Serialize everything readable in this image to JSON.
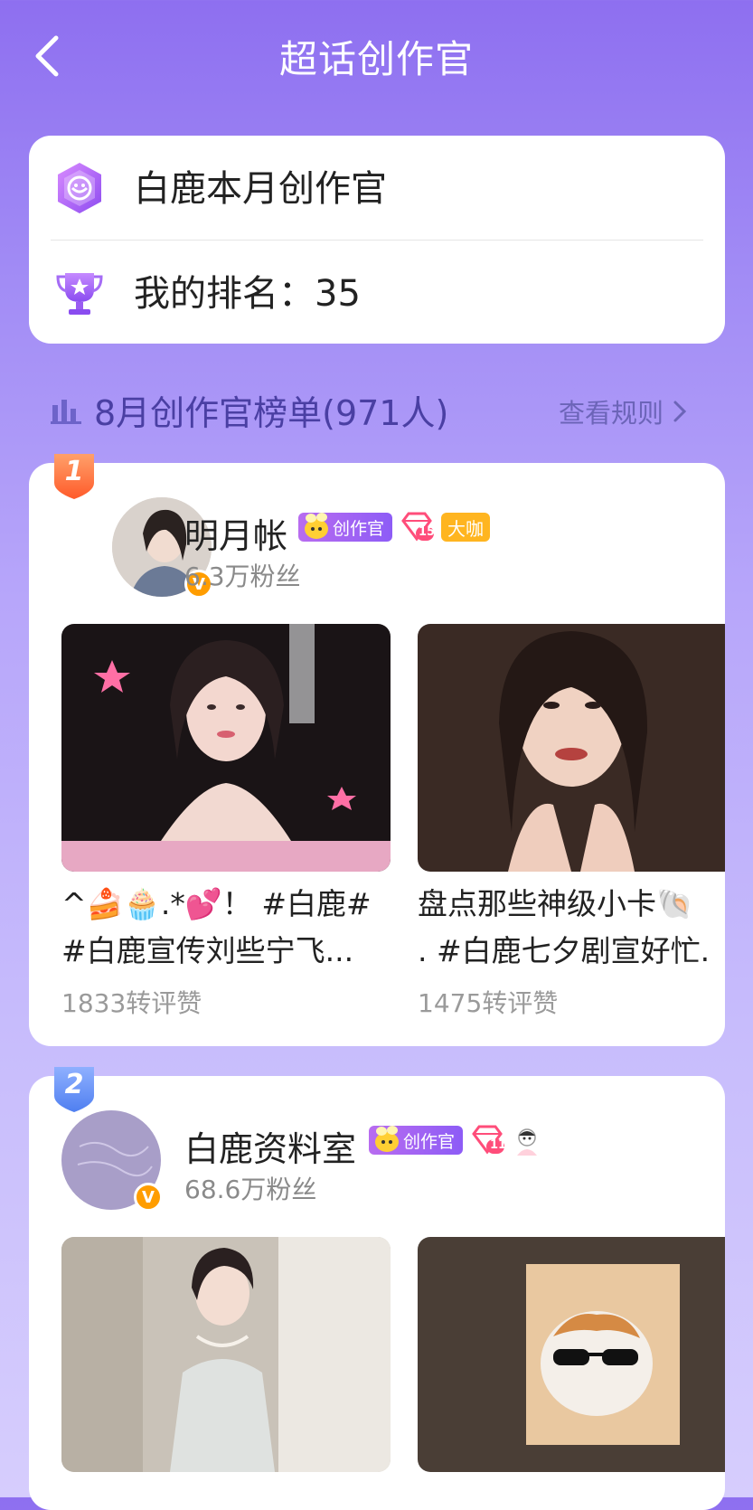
{
  "nav": {
    "title": "超话创作官"
  },
  "summary": {
    "title": "白鹿本月创作官",
    "rank_label": "我的排名：",
    "rank_value": "35"
  },
  "list": {
    "title": "8月创作官榜单(971人)",
    "rule_link": "查看规则"
  },
  "rankings": [
    {
      "rank": "1",
      "username": "明月帐",
      "creator_tag": "创作官",
      "level": "15",
      "extra_tag": "大咖",
      "fans": "6.3万粉丝",
      "posts": [
        {
          "line1": "^🍰🧁.*💕！ #白鹿#",
          "line2": "#白鹿宣传刘些宁飞...",
          "stats": "1833转评赞"
        },
        {
          "line1": "盘点那些神级小卡🐚",
          "line2": ". #白鹿七夕剧宣好忙.",
          "stats": "1475转评赞"
        }
      ]
    },
    {
      "rank": "2",
      "username": "白鹿资料室",
      "creator_tag": "创作官",
      "level": "11",
      "fans": "68.6万粉丝"
    }
  ],
  "colors": {
    "bg_top": "#8e6ff0",
    "bg_bottom": "#d6cdfd",
    "accent_purple": "#8d5cf6",
    "rank1_badge": "#ff7a3d",
    "rank2_badge": "#5f8cf2",
    "verified": "#ff9d00"
  },
  "icons": [
    "back-chevron-icon",
    "creator-badge-icon",
    "trophy-icon",
    "bar-chart-icon",
    "chevron-right-icon",
    "verified-v-icon",
    "diamond-level-icon",
    "bee-creator-icon"
  ]
}
